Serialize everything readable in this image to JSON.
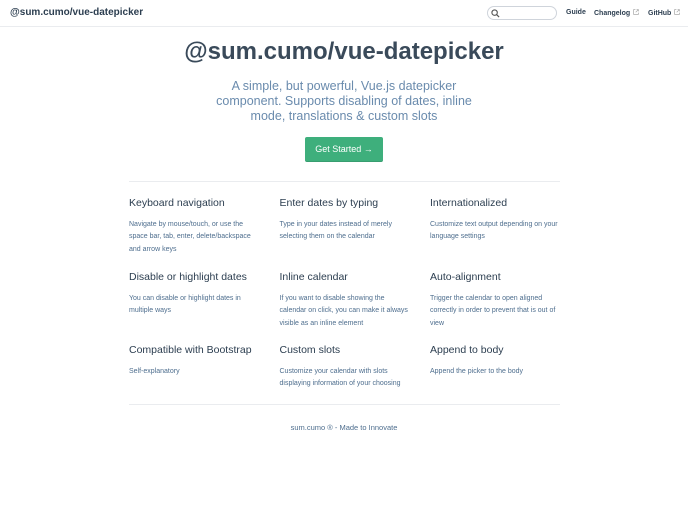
{
  "navbar": {
    "site_title": "@sum.cumo/vue-datepicker",
    "search_placeholder": "",
    "links": [
      {
        "label": "Guide",
        "external": false
      },
      {
        "label": "Changelog",
        "external": true
      },
      {
        "label": "GitHub",
        "external": true
      }
    ]
  },
  "hero": {
    "title": "@sum.cumo/vue-datepicker",
    "description": "A simple, but powerful, Vue.js datepicker component. Supports disabling of dates, inline mode, translations & custom slots",
    "action_label": "Get Started →"
  },
  "features": [
    {
      "title": "Keyboard navigation",
      "details": "Navigate by mouse/touch, or use the space bar, tab, enter, delete/backspace and arrow keys"
    },
    {
      "title": "Enter dates by typing",
      "details": "Type in your dates instead of merely selecting them on the calendar"
    },
    {
      "title": "Internationalized",
      "details": "Customize text output depending on your language settings"
    },
    {
      "title": "Disable or highlight dates",
      "details": "You can disable or highlight dates in multiple ways"
    },
    {
      "title": "Inline calendar",
      "details": "If you want to disable showing the calendar on click, you can make it always visible as an inline element"
    },
    {
      "title": "Auto-alignment",
      "details": "Trigger the calendar to open aligned correctly in order to prevent that is out of view"
    },
    {
      "title": "Compatible with Bootstrap",
      "details": "Self-explanatory"
    },
    {
      "title": "Custom slots",
      "details": "Customize your calendar with slots displaying information of your choosing"
    },
    {
      "title": "Append to body",
      "details": "Append the picker to the body"
    }
  ],
  "footer": {
    "text": "sum.cumo ® - Made to Innovate"
  },
  "colors": {
    "accent": "#3eaf7c",
    "text": "#2c3e50",
    "muted": "#6a8bad"
  },
  "icons": {
    "search": "search-icon",
    "external": "external-link-icon"
  }
}
